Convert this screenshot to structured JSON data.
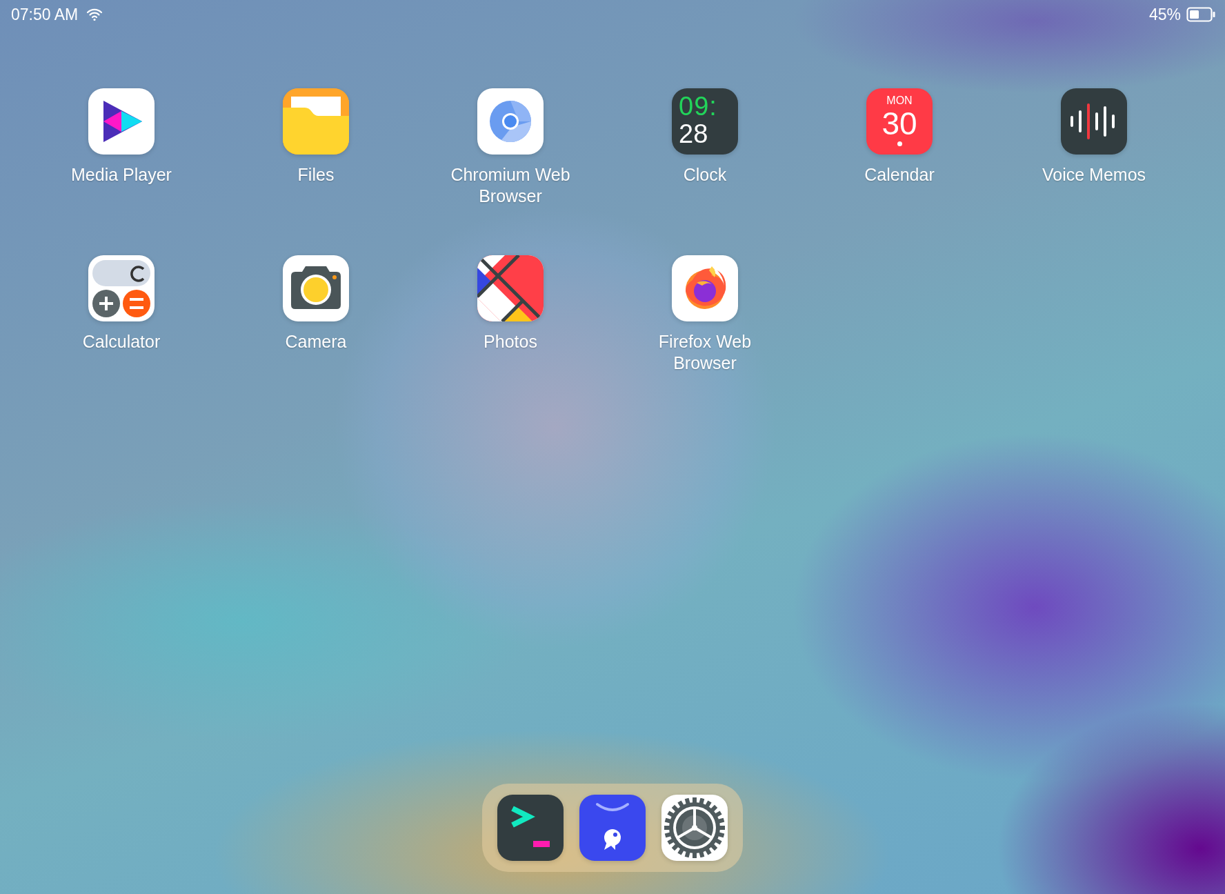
{
  "status_bar": {
    "time": "07:50 AM",
    "battery_percent": "45%"
  },
  "apps": [
    {
      "label": "Media Player",
      "kind": "media"
    },
    {
      "label": "Files",
      "kind": "files"
    },
    {
      "label": "Chromium Web Browser",
      "kind": "chromium"
    },
    {
      "label": "Clock",
      "kind": "clock",
      "icon_text": [
        "09:",
        "28"
      ]
    },
    {
      "label": "Calendar",
      "kind": "calendar",
      "icon_text": [
        "MON",
        "30"
      ]
    },
    {
      "label": "Voice Memos",
      "kind": "voice"
    },
    {
      "label": "Calculator",
      "kind": "calculator"
    },
    {
      "label": "Camera",
      "kind": "camera"
    },
    {
      "label": "Photos",
      "kind": "photos"
    },
    {
      "label": "Firefox Web Browser",
      "kind": "firefox"
    }
  ],
  "dock": [
    {
      "kind": "terminal"
    },
    {
      "kind": "store"
    },
    {
      "kind": "settings"
    }
  ]
}
